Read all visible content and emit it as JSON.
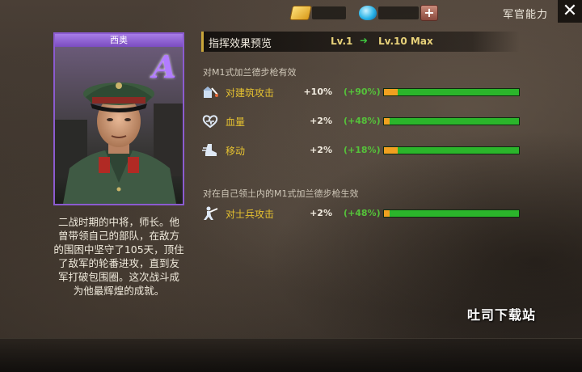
{
  "topbar": {
    "gold_icon": "gold-bar-icon",
    "gem_icon": "diamond-icon",
    "add_label": "+",
    "title": "军官能力",
    "close_label": "✕"
  },
  "officer": {
    "name": "西奥",
    "rank": "A",
    "bio": "二战时期的中将，师长。他曾带领自己的部队，在敌方的围困中坚守了105天，顶住了敌军的轮番进攻，直到友军打破包围圈。这次战斗成为他最辉煌的成就。"
  },
  "effects": {
    "title": "指挥效果预览",
    "level_current": "Lv.1",
    "level_max": "Lv.10 Max",
    "arrow": "➜",
    "sections": [
      {
        "label": "对M1式加兰德步枪有效",
        "stats": [
          {
            "icon": "building-attack-icon",
            "label": "对建筑攻击",
            "value": "+10%",
            "bonus": "(+90%)",
            "progress": 0.1
          },
          {
            "icon": "heart-icon",
            "label": "血量",
            "value": "+2%",
            "bonus": "(+48%)",
            "progress": 0.04
          },
          {
            "icon": "boot-icon",
            "label": "移动",
            "value": "+2%",
            "bonus": "(+18%)",
            "progress": 0.1
          }
        ]
      },
      {
        "label": "对在自己领土内的M1式加兰德步枪生效",
        "stats": [
          {
            "icon": "infantry-attack-icon",
            "label": "对士兵攻击",
            "value": "+2%",
            "bonus": "(+48%)",
            "progress": 0.04
          }
        ]
      }
    ]
  },
  "watermark": "吐司下载站",
  "colors": {
    "card_border": "#8b5bd0",
    "stat_label": "#e6c230",
    "bonus": "#55c23a",
    "bar_base": "#2bb52b",
    "bar_fill": "#f0a020"
  }
}
